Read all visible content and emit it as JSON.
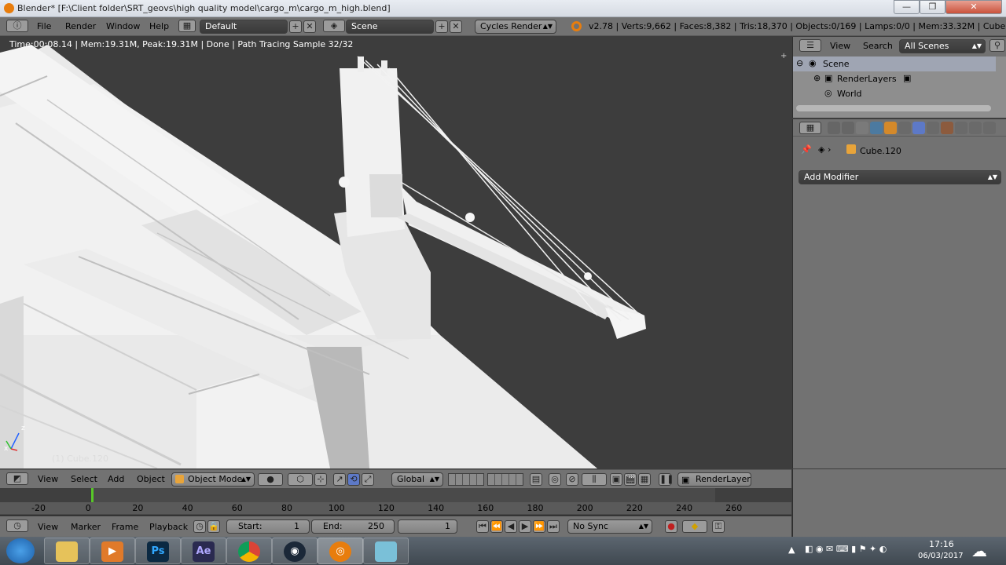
{
  "window": {
    "title": "Blender* [F:\\Client folder\\SRT_geovs\\high quality model\\cargo_m\\cargo_m_high.blend]",
    "minimize": "—",
    "maximize": "❐",
    "close": "✕"
  },
  "topbar": {
    "menu": [
      "File",
      "Render",
      "Window",
      "Help"
    ],
    "screen_layout": "Default",
    "scene": "Scene",
    "engine": "Cycles Render",
    "stats": "v2.78 | Verts:9,662 | Faces:8,382 | Tris:18,370 | Objects:0/169 | Lamps:0/0 | Mem:33.32M | Cube.120"
  },
  "viewport": {
    "render_status": "Time:00:08.14 | Mem:19.31M, Peak:19.31M | Done | Path Tracing Sample 32/32",
    "object_label": "(1) Cube.120",
    "axis_x": "x",
    "axis_z": "z"
  },
  "outliner": {
    "view": "View",
    "search": "Search",
    "filter": "All Scenes",
    "items": [
      {
        "label": "Scene"
      },
      {
        "label": "RenderLayers"
      },
      {
        "label": "World"
      }
    ]
  },
  "properties": {
    "object_name": "Cube.120",
    "add_modifier": "Add Modifier"
  },
  "viewport_header": {
    "menu": [
      "View",
      "Select",
      "Add",
      "Object"
    ],
    "mode": "Object Mode",
    "orientation": "Global",
    "render_layer": "RenderLayer"
  },
  "timeline": {
    "ticks": [
      "-20",
      "0",
      "20",
      "40",
      "60",
      "80",
      "100",
      "120",
      "140",
      "160",
      "180",
      "200",
      "220",
      "240",
      "260"
    ],
    "current_frame_marker": 0,
    "menu": [
      "View",
      "Marker",
      "Frame",
      "Playback"
    ],
    "start_label": "Start:",
    "start_value": "1",
    "end_label": "End:",
    "end_value": "250",
    "current_frame": "1",
    "sync": "No Sync"
  },
  "taskbar": {
    "apps": [
      "Explorer",
      "Media Player",
      "Photoshop",
      "After Effects",
      "Chrome",
      "Steam",
      "Blender",
      "App"
    ],
    "ps_label": "Ps",
    "ae_label": "Ae",
    "time": "17:16",
    "date": "06/03/2017"
  },
  "colors": {
    "accent_orange": "#e87d0d",
    "selected_row": "#9fa5b3",
    "frame_marker": "#58c828"
  }
}
